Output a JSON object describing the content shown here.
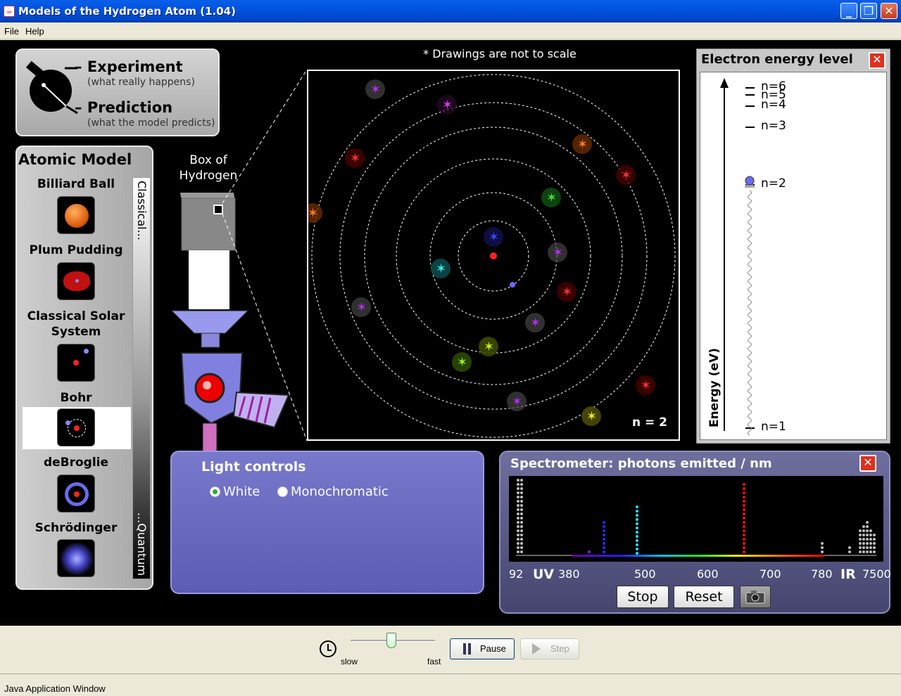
{
  "window": {
    "title": "Models of the Hydrogen Atom (1.04)"
  },
  "menu": {
    "file": "File",
    "help": "Help"
  },
  "legend": {
    "experiment": "Experiment",
    "experiment_sub": "(what really happens)",
    "prediction": "Prediction",
    "prediction_sub": "(what the model predicts)"
  },
  "atomic_model": {
    "heading": "Atomic Model",
    "models": [
      "Billiard Ball",
      "Plum Pudding",
      "Classical Solar System",
      "Bohr",
      "deBroglie",
      "Schrödinger"
    ],
    "selected": "Bohr",
    "scale_top": "Classical...",
    "scale_bottom": "...Quantum"
  },
  "box": {
    "label": "Box of Hydrogen"
  },
  "atom_view": {
    "note": "* Drawings are not to scale",
    "state_label": "n = 2"
  },
  "energy_panel": {
    "title": "Electron energy level",
    "axis_label": "Energy (eV)",
    "levels": [
      "n=6",
      "n=5",
      "n=4",
      "n=3",
      "n=2",
      "n=1"
    ],
    "current_level": "n=2"
  },
  "light_controls": {
    "title": "Light controls",
    "options": [
      "White",
      "Monochromatic"
    ],
    "selected": "White"
  },
  "spectrometer": {
    "title": "Spectrometer: photons emitted / nm",
    "ticks": [
      "92",
      "UV",
      "380",
      "500",
      "600",
      "700",
      "780",
      "IR",
      "7500"
    ],
    "stop_label": "Stop",
    "reset_label": "Reset",
    "camera_icon": "camera-icon"
  },
  "sim_controls": {
    "slow": "slow",
    "fast": "fast",
    "pause": "Pause",
    "step": "Step",
    "speed_fraction": 0.48
  },
  "status": {
    "text": "Java Application Window"
  },
  "colors": {
    "panel_blue": "#6a6ac0",
    "title_blue": "#0053E1",
    "close_red": "#e0301e"
  }
}
